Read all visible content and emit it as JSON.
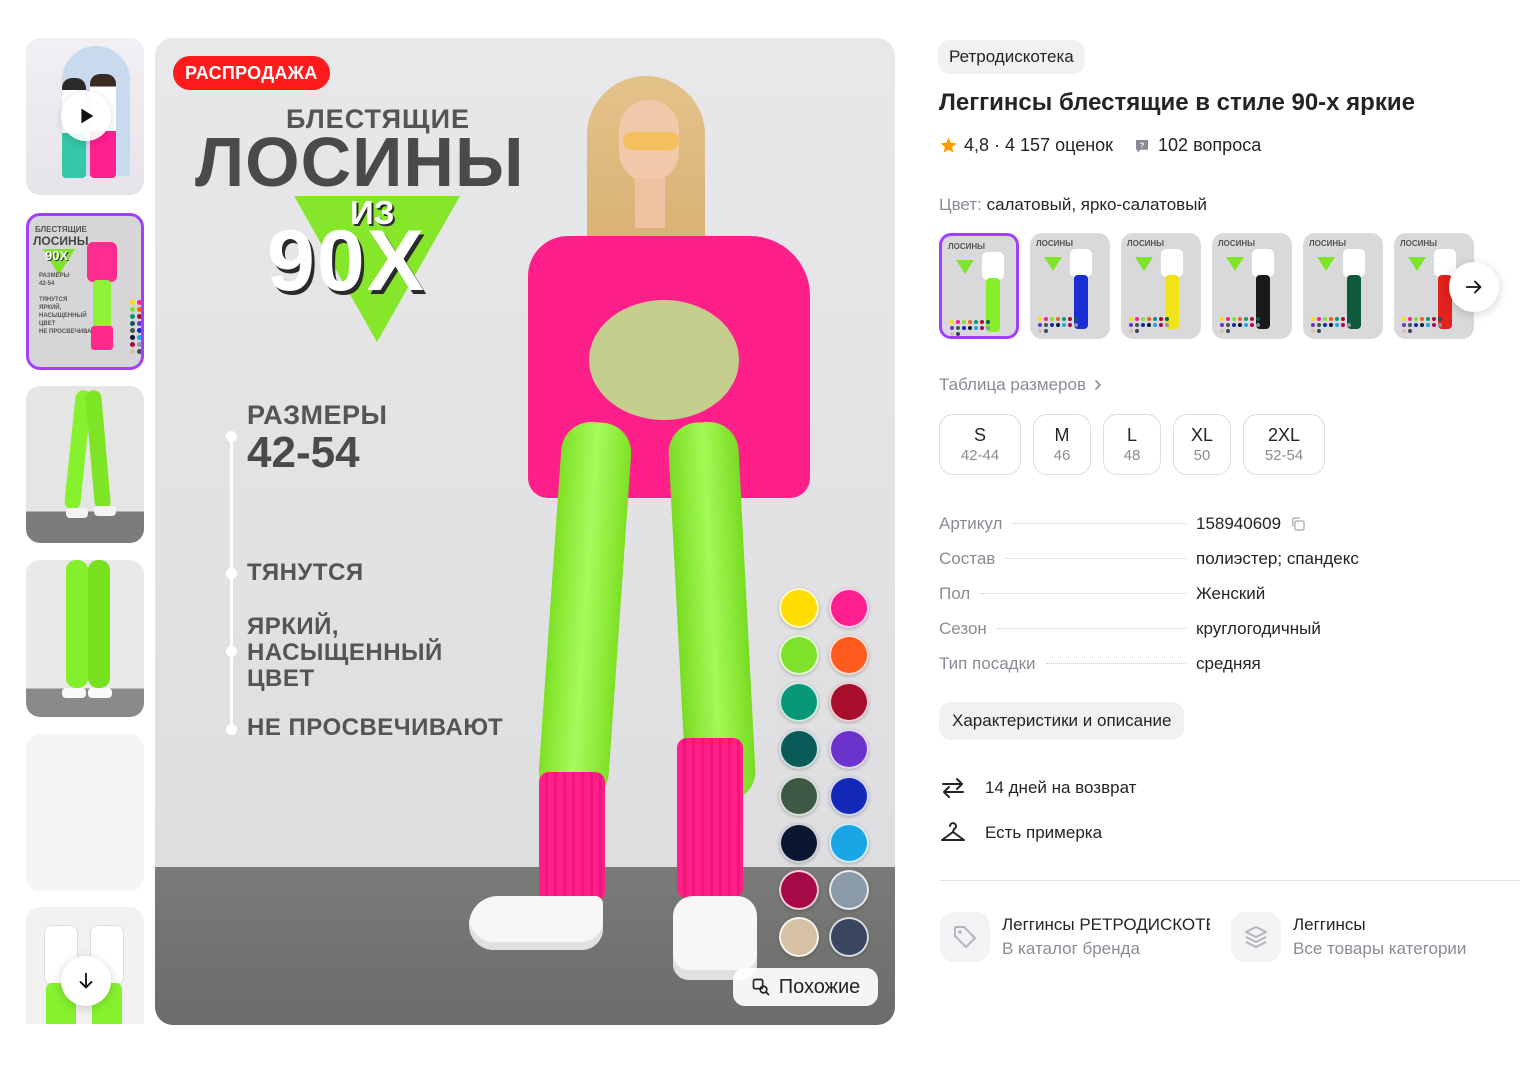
{
  "gallery": {
    "sale_badge": "РАСПРОДАЖА",
    "promo": {
      "line1": "БЛЕСТЯЩИЕ",
      "line2": "ЛОСИНЫ",
      "from": "ИЗ",
      "decade": "90Х",
      "sizes_label": "РАЗМЕРЫ",
      "sizes_value": "42-54",
      "features": [
        "ТЯНУТСЯ",
        "ЯРКИЙ,\nНАСЫЩЕННЫЙ\nЦВЕТ",
        "НЕ ПРОСВЕЧИВАЮТ"
      ]
    },
    "thumb_main": {
      "t1": "БЛЕСТЯЩИЕ",
      "t2": "ЛОСИНЫ",
      "t3": "90Х",
      "small": "РАЗМЕРЫ\n42-54\n\nТЯНУТСЯ\nЯРКИЙ,\nНАСЫЩЕННЫЙ\nЦВЕТ\nНЕ ПРОСВЕЧИВАЮТ"
    },
    "swatch_colors": [
      "#ffdd00",
      "#ff1f8f",
      "#7ee22c",
      "#ff5b1f",
      "#079977",
      "#a80d2c",
      "#0a5a5a",
      "#6c33cc",
      "#3c5a43",
      "#1229b8",
      "#0b1730",
      "#1aa6e6",
      "#a50a47",
      "#8a9aa8",
      "#d7c1a4",
      "#3a4560"
    ],
    "similar_button": "Похожие",
    "icons": {
      "play": "play-icon",
      "down": "arrow-down-icon",
      "similar": "search-similar-icon"
    }
  },
  "product": {
    "brand": "Ретродискотека",
    "title": "Леггинсы блестящие в стиле 90-х яркие",
    "rating": "4,8",
    "rating_sep": " · ",
    "reviews": "4 157 оценок",
    "questions": "102 вопроса",
    "color_label": "Цвет:",
    "color_value": "салатовый, ярко-салатовый",
    "variant_legs": [
      "#86ef2c",
      "#1b2ed4",
      "#f2e21a",
      "#1a1a1a",
      "#0f5a3a",
      "#e3221d"
    ],
    "size_table_link": "Таблица размеров",
    "sizes": [
      {
        "label": "S",
        "ru": "42-44"
      },
      {
        "label": "M",
        "ru": "46"
      },
      {
        "label": "L",
        "ru": "48"
      },
      {
        "label": "XL",
        "ru": "50"
      },
      {
        "label": "2XL",
        "ru": "52-54"
      }
    ],
    "specs": [
      {
        "key": "Артикул",
        "value": "158940609"
      },
      {
        "key": "Состав",
        "value": "полиэстер; спандекс"
      },
      {
        "key": "Пол",
        "value": "Женский"
      },
      {
        "key": "Сезон",
        "value": "круглогодичный"
      },
      {
        "key": "Тип посадки",
        "value": "средняя"
      }
    ],
    "characteristics_button": "Характеристики и описание",
    "return_text": "14 дней на возврат",
    "fitting_text": "Есть примерка",
    "brand_link": {
      "title": "Леггинсы РЕТРОДИСКОТЕКА",
      "subtitle": "В каталог бренда"
    },
    "category_link": {
      "title": "Леггинсы",
      "subtitle": "Все товары категории"
    }
  },
  "colors": {
    "accent": "#a340ff",
    "sale": "#ff1b1b",
    "star": "#ff9c00",
    "muted_text": "#8b8b95"
  }
}
